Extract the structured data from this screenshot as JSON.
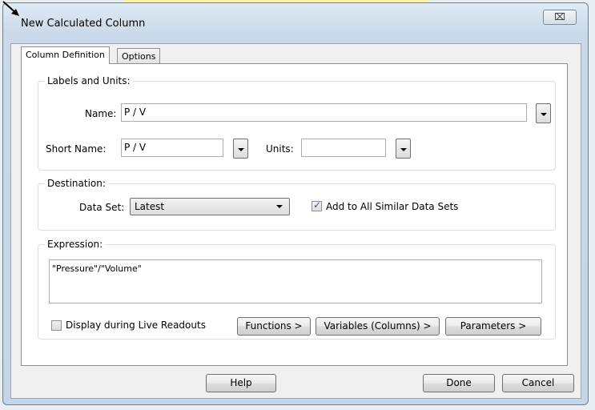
{
  "dialog": {
    "title": "New Calculated Column",
    "close_symbol": "⌧"
  },
  "tabs": [
    {
      "label": "Column Definition"
    },
    {
      "label": "Options"
    }
  ],
  "labels_units": {
    "legend": "Labels and Units:",
    "name_label": "Name:",
    "name_value": "P / V",
    "short_name_label": "Short Name:",
    "short_name_value": "P / V",
    "units_label": "Units:",
    "units_value": ""
  },
  "destination": {
    "legend": "Destination:",
    "data_set_label": "Data Set:",
    "data_set_value": "Latest",
    "add_all_label": "Add to All Similar Data Sets",
    "add_all_checked": true
  },
  "expression": {
    "legend": "Expression:",
    "value": "\"Pressure\"/\"Volume\"",
    "live_label": "Display during Live Readouts",
    "live_checked": false,
    "functions_button": "Functions >",
    "variables_button": "Variables (Columns) >",
    "parameters_button": "Parameters >"
  },
  "footer": {
    "help_button": "Help",
    "done_button": "Done",
    "cancel_button": "Cancel"
  }
}
